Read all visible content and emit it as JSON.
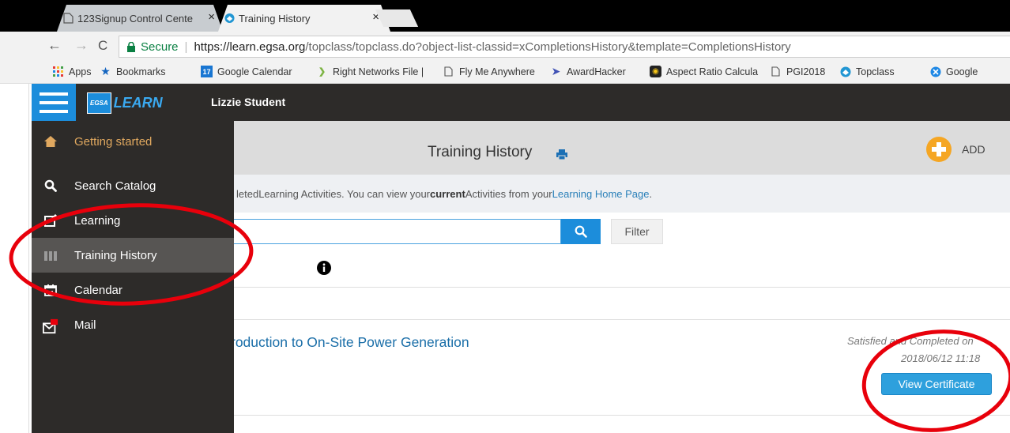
{
  "browser": {
    "tabs": [
      {
        "title": "123Signup Control Cente",
        "close": "×",
        "active": false
      },
      {
        "title": "Training History",
        "close": "×",
        "active": true
      }
    ],
    "nav": {
      "back": "←",
      "forward": "→",
      "reload": "C"
    },
    "address": {
      "security_label": "Secure",
      "separator": "|",
      "url_host": "https://learn.egsa.org",
      "url_path": "/topclass/topclass.do?object-list-classid=xCompletionsHistory&template=CompletionsHistory"
    },
    "bookmarks": [
      {
        "label": "Apps",
        "icon": "apps-grid-icon"
      },
      {
        "label": "Bookmarks",
        "icon": "star-icon"
      },
      {
        "label": "Google Calendar",
        "icon": "calendar-icon",
        "icon_text": "17"
      },
      {
        "label": "Right Networks File |",
        "icon": "arrows-icon"
      },
      {
        "label": "Fly Me Anywhere",
        "icon": "page-icon"
      },
      {
        "label": "AwardHacker",
        "icon": "send-icon"
      },
      {
        "label": "Aspect Ratio Calcula",
        "icon": "aspect-icon"
      },
      {
        "label": "PGI2018",
        "icon": "page-icon"
      },
      {
        "label": "Topclass",
        "icon": "topclass-icon"
      },
      {
        "label": "Google",
        "icon": "google-icon"
      }
    ]
  },
  "app": {
    "logo_badge": "EGSA",
    "logo_text": "LEARN",
    "user_name": "Lizzie Student",
    "sidebar": [
      {
        "label": "Getting started",
        "icon": "home-icon"
      },
      {
        "label": "Search Catalog",
        "icon": "search-icon"
      },
      {
        "label": "Learning",
        "icon": "edit-icon"
      },
      {
        "label": "Training History",
        "icon": "books-icon"
      },
      {
        "label": "Calendar",
        "icon": "calendar-icon"
      },
      {
        "label": "Mail",
        "icon": "mail-icon"
      }
    ],
    "page_title": "Training History",
    "add_label": "ADD",
    "info": {
      "pre": "leted",
      "mid1": " Learning Activities. You can view your ",
      "bold": "current",
      "mid2": " Activities from your ",
      "link": "Learning Home Page",
      "end": "."
    },
    "filter_label": "Filter",
    "history_item": {
      "title": "roduction to On-Site Power Generation",
      "status_line1": "Satisfied and Completed on",
      "status_line2": "2018/06/12 11:18",
      "button": "View Certificate"
    }
  },
  "colors": {
    "sidebar_bg": "#2d2b29",
    "getting_started_text": "#e0a85f",
    "active_item_bg": "#575553",
    "accent_blue": "#1c8ddb",
    "link_blue": "#2a80b9",
    "add_orange": "#f5a623",
    "annotation_red": "#e8000b"
  }
}
